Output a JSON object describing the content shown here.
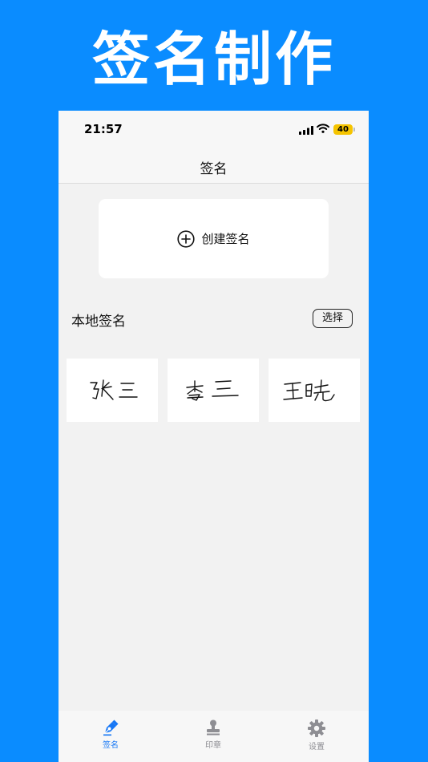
{
  "banner": {
    "title": "签名制作"
  },
  "status_bar": {
    "time": "21:57",
    "battery_level": "40",
    "battery_color": "#F5C400"
  },
  "nav": {
    "title": "签名"
  },
  "create_card": {
    "label": "创建签名",
    "icon": "plus-circle-icon"
  },
  "local_section": {
    "title": "本地签名",
    "select_label": "选择"
  },
  "signatures": [
    {
      "name": "张三"
    },
    {
      "name": "李三"
    },
    {
      "name": "王晓"
    }
  ],
  "tabs": [
    {
      "label": "签名",
      "icon": "pen-icon",
      "active": true
    },
    {
      "label": "印章",
      "icon": "stamp-icon",
      "active": false
    },
    {
      "label": "设置",
      "icon": "gear-icon",
      "active": false
    }
  ],
  "colors": {
    "background": "#0A8CFF",
    "accent": "#1677F5",
    "inactive": "#8E8E93"
  }
}
